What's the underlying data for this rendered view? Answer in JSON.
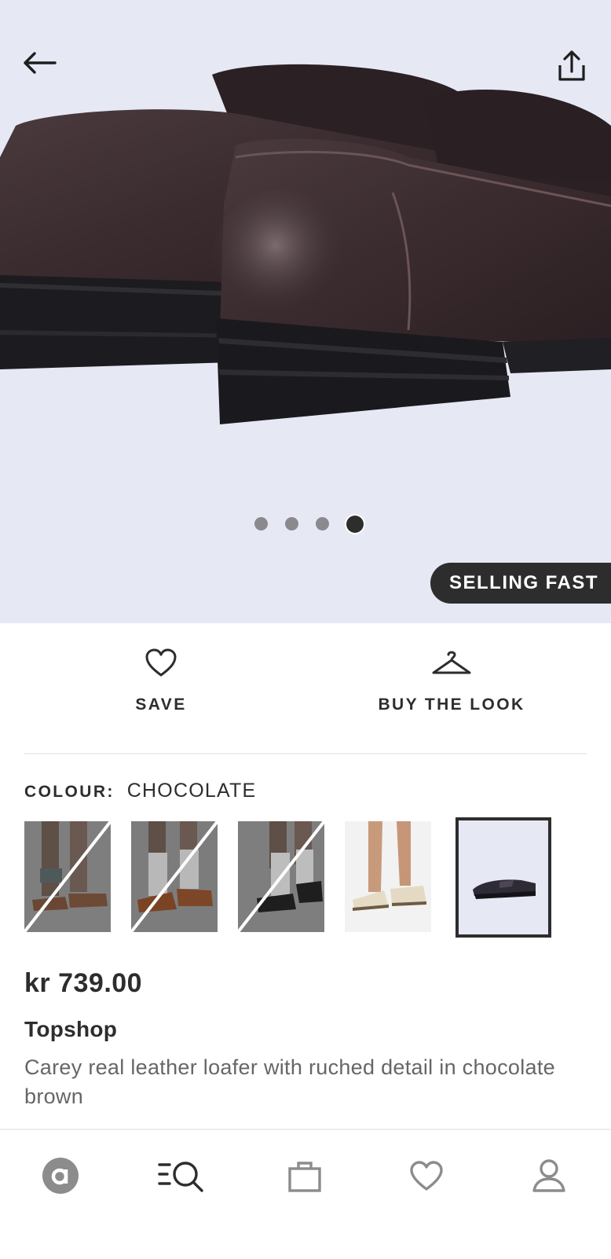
{
  "colors": {
    "ink": "#2d2d2d",
    "muted": "#666666",
    "hero_bg": "#e6e8f4",
    "divider": "#eeeeee"
  },
  "header": {
    "back_icon": "arrow-left-icon",
    "share_icon": "share-icon"
  },
  "gallery": {
    "image_count": 4,
    "active_index": 4,
    "badge": "SELLING FAST"
  },
  "actions": {
    "save": {
      "label": "SAVE",
      "icon": "heart-icon"
    },
    "buy_the_look": {
      "label": "BUY THE LOOK",
      "icon": "hanger-icon"
    }
  },
  "colour": {
    "label": "COLOUR:",
    "value": "CHOCOLATE",
    "swatches": [
      {
        "name": "sandal-tan",
        "available": false
      },
      {
        "name": "loafer-brown",
        "available": false
      },
      {
        "name": "loafer-black",
        "available": false
      },
      {
        "name": "loafer-cream",
        "available": true
      },
      {
        "name": "loafer-chocolate",
        "available": true,
        "selected": true
      }
    ]
  },
  "product": {
    "price": "kr 739.00",
    "brand": "Topshop",
    "description": "Carey real leather loafer with ruched detail in chocolate brown"
  },
  "tabbar": {
    "items": [
      {
        "icon": "home-logo-icon"
      },
      {
        "icon": "search-icon"
      },
      {
        "icon": "bag-icon"
      },
      {
        "icon": "saved-heart-icon"
      },
      {
        "icon": "account-icon"
      }
    ]
  }
}
